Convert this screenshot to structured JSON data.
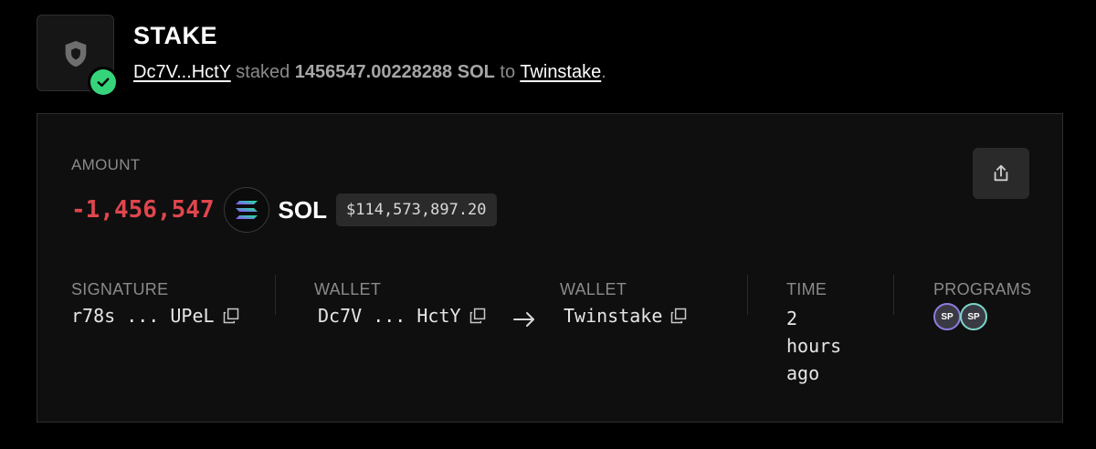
{
  "header": {
    "title": "STAKE",
    "from_wallet": "Dc7V...HctY",
    "verb": "staked",
    "amount_text": "1456547.00228288 SOL",
    "to_word": "to",
    "to_wallet": "Twinstake",
    "period": "."
  },
  "card": {
    "amount_label": "AMOUNT",
    "amount_value": "-1,456,547",
    "token_symbol": "SOL",
    "usd_value": "$114,573,897.20",
    "signature": {
      "label": "SIGNATURE",
      "value": "r78s ... UPeL"
    },
    "from": {
      "label": "WALLET",
      "value": "Dc7V ... HctY"
    },
    "to": {
      "label": "WALLET",
      "value": "Twinstake"
    },
    "time": {
      "label": "TIME",
      "value": "2 hours ago"
    },
    "programs": {
      "label": "PROGRAMS",
      "badges": [
        "SP",
        "SP"
      ]
    }
  },
  "colors": {
    "negative_amount": "#e0464d",
    "success_check": "#36d47a",
    "background": "#000000",
    "card_background": "#0f0f0f"
  },
  "icons": {
    "tx_type": "shield-icon",
    "status": "check-circle-icon",
    "token": "solana-logo-icon",
    "share": "share-icon",
    "copy": "copy-icon",
    "direction": "arrow-right-icon"
  }
}
